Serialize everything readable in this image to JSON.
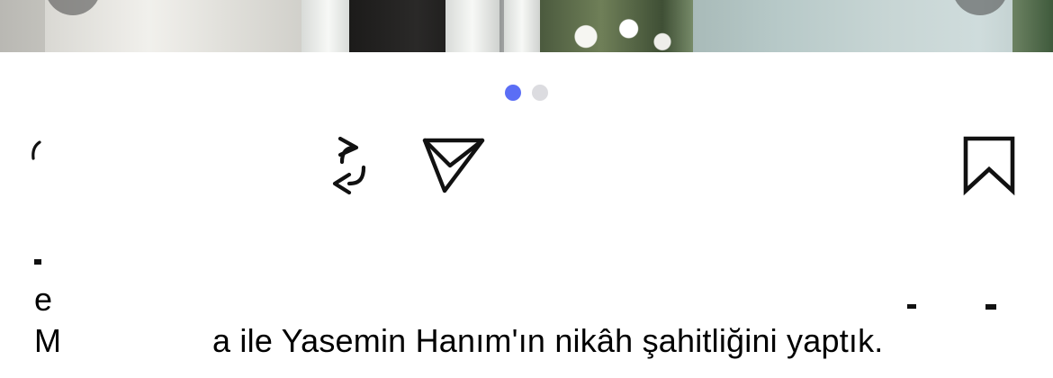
{
  "colors": {
    "active_dot": "#5b6ef5",
    "inactive_dot": "#dcdce0",
    "icon": "#111111",
    "text": "#000000"
  },
  "carousel": {
    "total_pages": 2,
    "current_page": 1
  },
  "actions": {
    "like_icon": "heart-icon",
    "repost_icon": "repost-icon",
    "share_icon": "send-icon",
    "save_icon": "bookmark-icon"
  },
  "caption": {
    "line1_fragment": "e",
    "line2_left": "M",
    "line2_right": "a ile Yasemin Hanım'ın nikâh şahitliğini yaptık."
  }
}
